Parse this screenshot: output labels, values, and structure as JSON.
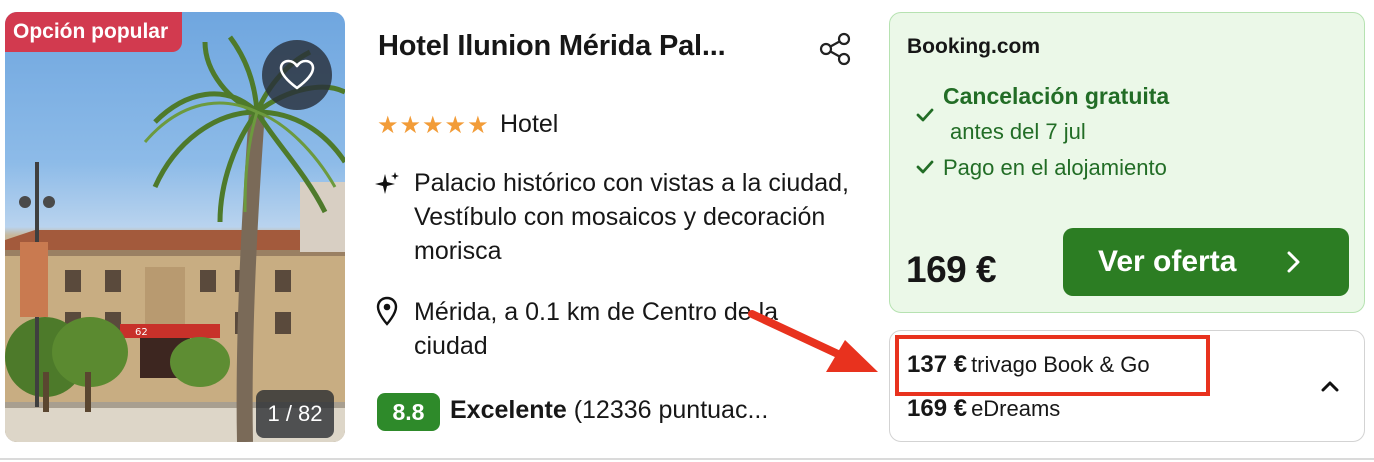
{
  "photo": {
    "badge": "Opción popular",
    "counter": "1 / 82",
    "sign_text": "62",
    "favorite_icon": "heart-icon"
  },
  "hotel": {
    "name": "Hotel Ilunion Mérida Pal...",
    "stars": 5,
    "stars_text": [
      "★",
      "★",
      "★",
      "★",
      "★"
    ],
    "type": "Hotel",
    "highlight": "Palacio histórico con vistas a la ciudad, Vestíbulo con mosaicos y decoración morisca",
    "location": "Mérida, a 0.1 km de Centro de la ciudad",
    "rating_score": "8.8",
    "rating_label": "Excelente",
    "rating_count": "(12336 puntuac..."
  },
  "deal": {
    "provider": "Booking.com",
    "feature1": "Cancelación gratuita",
    "feature1_sub": "antes del 7 jul",
    "feature2": "Pago en el alojamiento",
    "price": "169 €",
    "cta": "Ver oferta"
  },
  "other_prices": [
    {
      "price": "137 €",
      "provider": "trivago Book & Go"
    },
    {
      "price": "169 €",
      "provider": "eDreams"
    }
  ],
  "colors": {
    "badge": "#d23a4f",
    "star": "#f29c38",
    "rating": "#2e8a2a",
    "deal_bg": "#ebf8e8",
    "deal_text": "#226d26",
    "cta": "#2c7d23",
    "annotation": "#e8321e"
  }
}
